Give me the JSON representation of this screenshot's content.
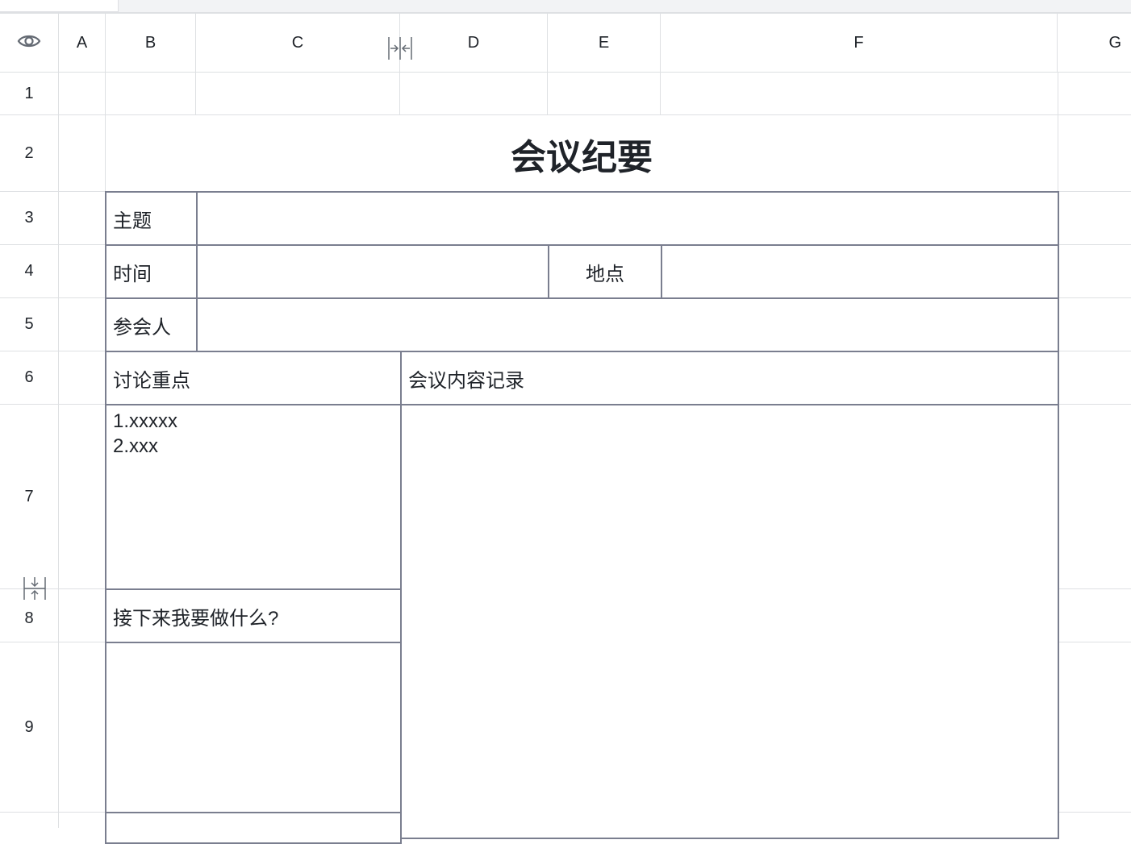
{
  "header": {
    "eye_icon": "eye-icon",
    "columns": [
      "A",
      "B",
      "C",
      "D",
      "E",
      "F",
      "G"
    ]
  },
  "rows": [
    "1",
    "2",
    "3",
    "4",
    "5",
    "6",
    "7",
    "8",
    "9"
  ],
  "sheet": {
    "title": "会议纪要",
    "subject_label": "主题",
    "time_label": "时间",
    "location_label": "地点",
    "attendees_label": "参会人",
    "discussion_label": "讨论重点",
    "record_label": "会议内容记录",
    "discussion_notes": "1.xxxxx\n2.xxx",
    "next_steps_label": "接下来我要做什么?"
  },
  "icons": {
    "column_resize": "column-resize-icon",
    "row_resize": "row-resize-icon"
  }
}
